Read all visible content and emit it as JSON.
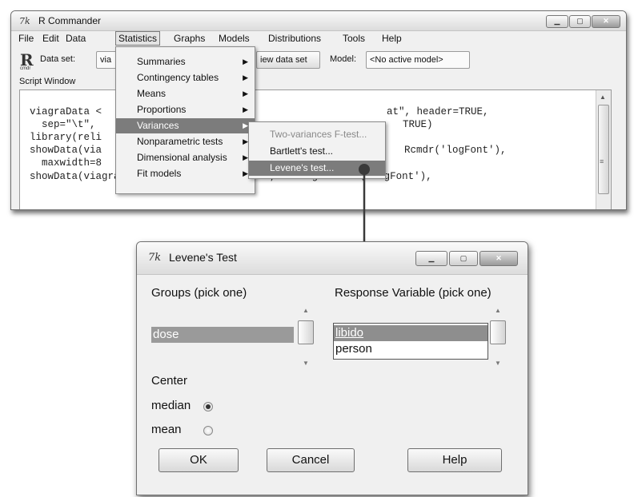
{
  "main_window": {
    "icon": "7k",
    "title": "R Commander",
    "menu": [
      "File",
      "Edit",
      "Data",
      "Statistics",
      "Graphs",
      "Models",
      "Distributions",
      "Tools",
      "Help"
    ],
    "toolbar": {
      "logo": "R",
      "logo_sub": "cmdr",
      "dataset_label": "Data set:",
      "dataset_value": "via",
      "view_button": "iew data set",
      "model_label": "Model:",
      "model_value": "<No active model>"
    },
    "script_label": "Script Window",
    "code_lines": [
      "viagraData <",
      "  sep=\"\\t\",",
      "library(reli",
      "showData(via",
      "  maxwidth=8",
      "showData(viagraData, placement='-20+200', font=getRcmdr('logFont'),"
    ],
    "code_fragments": [
      "at\", header=TRUE,",
      "TRUE)",
      "Rcmdr('logFont'),"
    ]
  },
  "statistics_menu": {
    "items": [
      "Summaries",
      "Contingency tables",
      "Means",
      "Proportions",
      "Variances",
      "Nonparametric tests",
      "Dimensional analysis",
      "Fit models"
    ],
    "highlighted": "Variances"
  },
  "variances_submenu": {
    "items": [
      "Two-variances F-test...",
      "Bartlett's test...",
      "Levene's test..."
    ],
    "highlighted": "Levene's test..."
  },
  "dialog": {
    "icon": "7k",
    "title": "Levene's Test",
    "groups_label": "Groups (pick one)",
    "groups_items": [
      "dose"
    ],
    "response_label": "Response Variable (pick one)",
    "response_items": [
      "libido",
      "person"
    ],
    "center_label": "Center",
    "center_options": [
      "median",
      "mean"
    ],
    "center_selected": "median",
    "buttons": {
      "ok": "OK",
      "cancel": "Cancel",
      "help": "Help"
    }
  },
  "colors": {
    "highlight": "#7c7c7c",
    "window_bg": "#f0f0f0"
  }
}
